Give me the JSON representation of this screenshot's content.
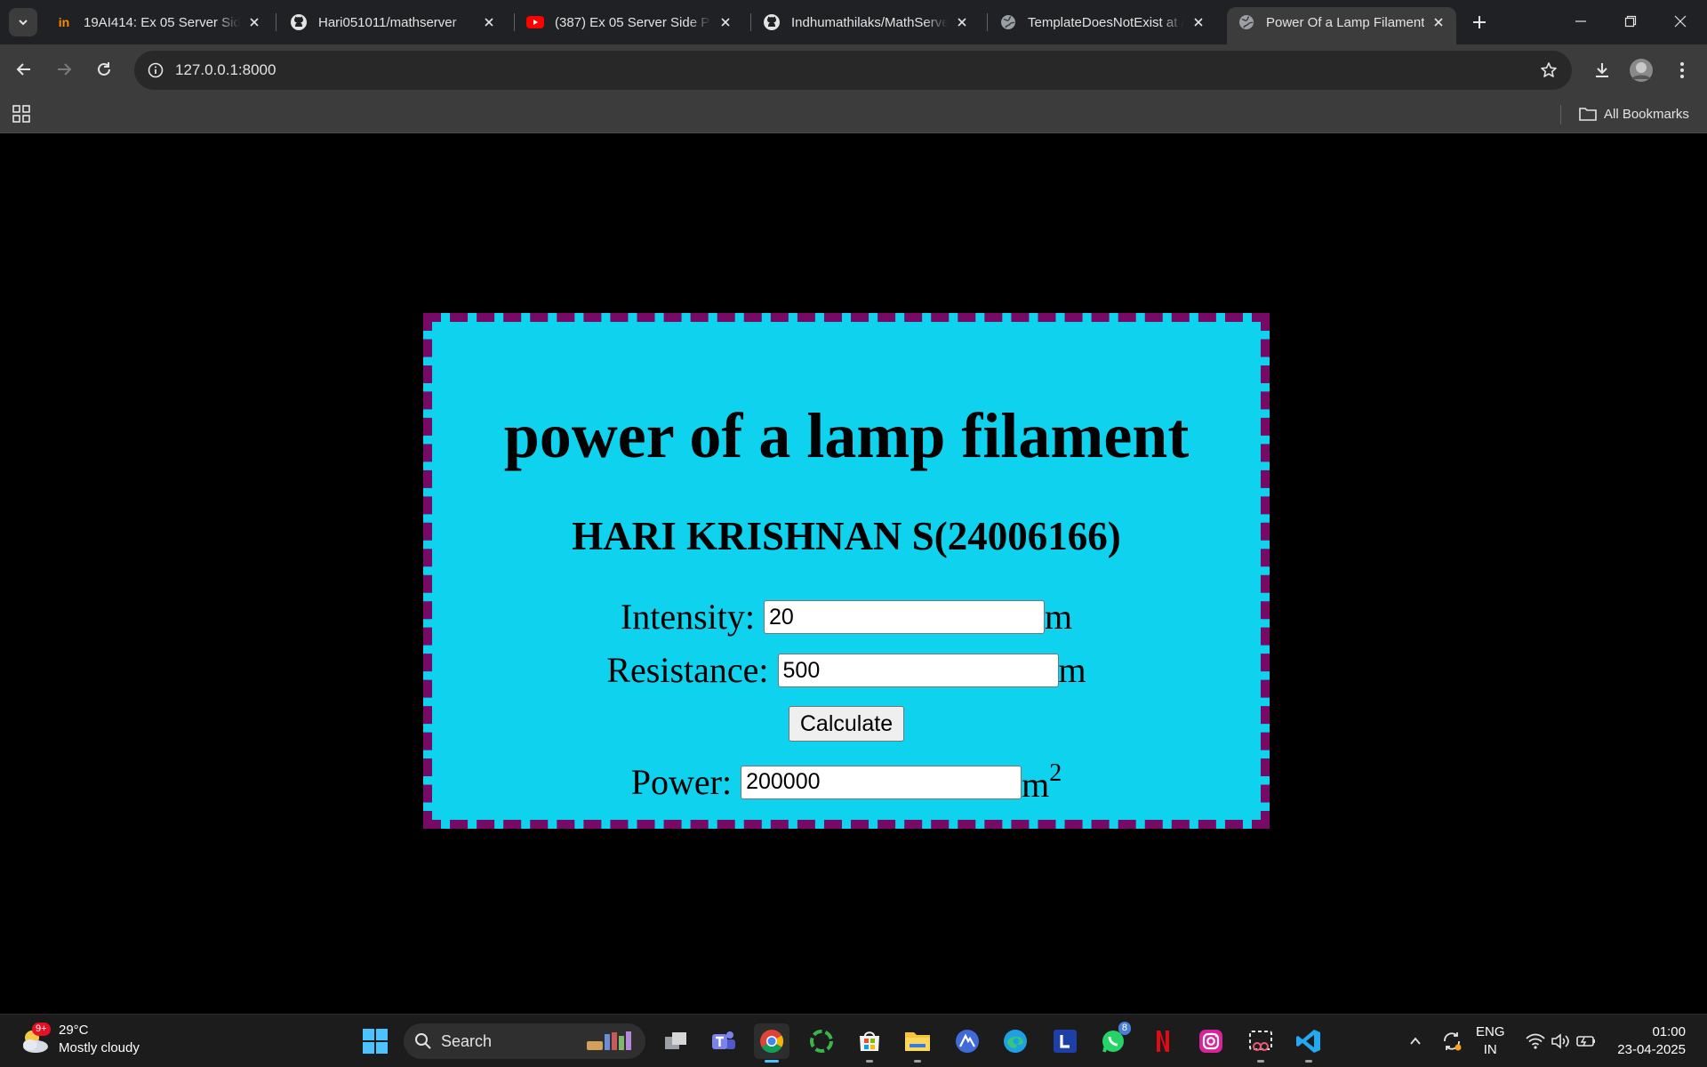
{
  "browser": {
    "tabs": [
      {
        "title": "19AI414: Ex 05 Server Side",
        "favicon": "in-icon",
        "active": false
      },
      {
        "title": "Hari051011/mathserver",
        "favicon": "github-icon",
        "active": false
      },
      {
        "title": "(387) Ex 05 Server Side Pro",
        "favicon": "youtube-icon",
        "active": false
      },
      {
        "title": "Indhumathilaks/MathServer",
        "favicon": "github-icon",
        "active": false
      },
      {
        "title": "TemplateDoesNotExist at /",
        "favicon": "globe-icon",
        "active": false
      },
      {
        "title": "Power Of a Lamp Filament",
        "favicon": "globe-icon",
        "active": true
      }
    ],
    "url": "127.0.0.1:8000",
    "bookmarks_label": "All Bookmarks"
  },
  "page": {
    "heading": "power of a lamp filament",
    "author": "HARI KRISHNAN S(24006166)",
    "intensity_label": "Intensity:",
    "intensity_value": "20",
    "intensity_unit": "m",
    "resistance_label": "Resistance:",
    "resistance_value": "500",
    "resistance_unit": "m",
    "calculate_label": "Calculate",
    "power_label": "Power:",
    "power_value": "200000",
    "power_unit": "m",
    "power_unit_sup": "2",
    "colors": {
      "card_bg": "#0fd2ef",
      "card_border": "#760a64",
      "page_bg": "#000000"
    }
  },
  "taskbar": {
    "weather_temp": "29°C",
    "weather_desc": "Mostly cloudy",
    "weather_badge": "9+",
    "search_placeholder": "Search",
    "whatsapp_badge": "8",
    "lang_top": "ENG",
    "lang_bottom": "IN",
    "time": "01:00",
    "date": "23-04-2025"
  }
}
